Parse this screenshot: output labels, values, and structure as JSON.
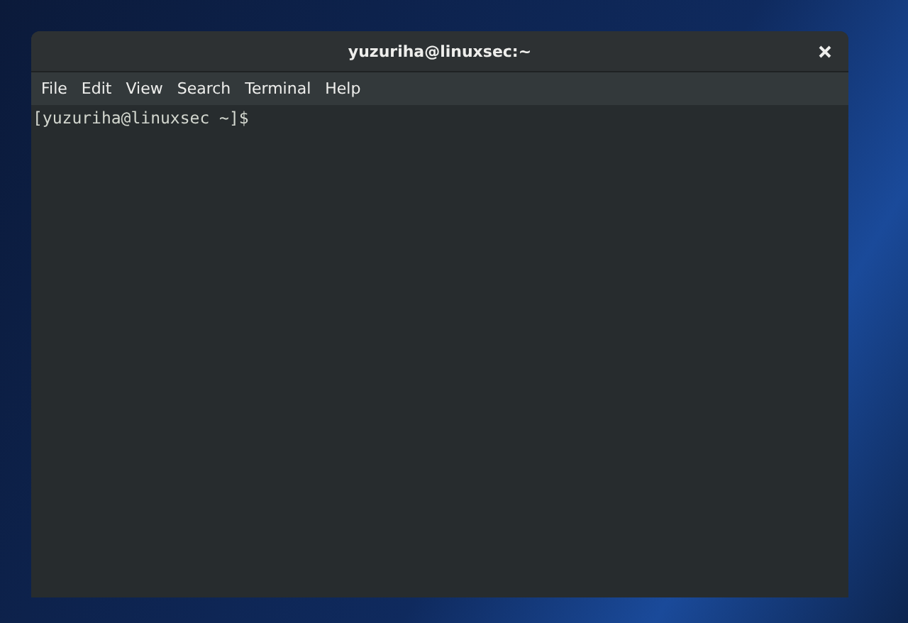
{
  "window": {
    "title": "yuzuriha@linuxsec:~"
  },
  "menu": [
    "File",
    "Edit",
    "View",
    "Search",
    "Terminal",
    "Help"
  ],
  "terminal": {
    "lines": [
      "[yuzuriha@linuxsec ~]$"
    ]
  }
}
